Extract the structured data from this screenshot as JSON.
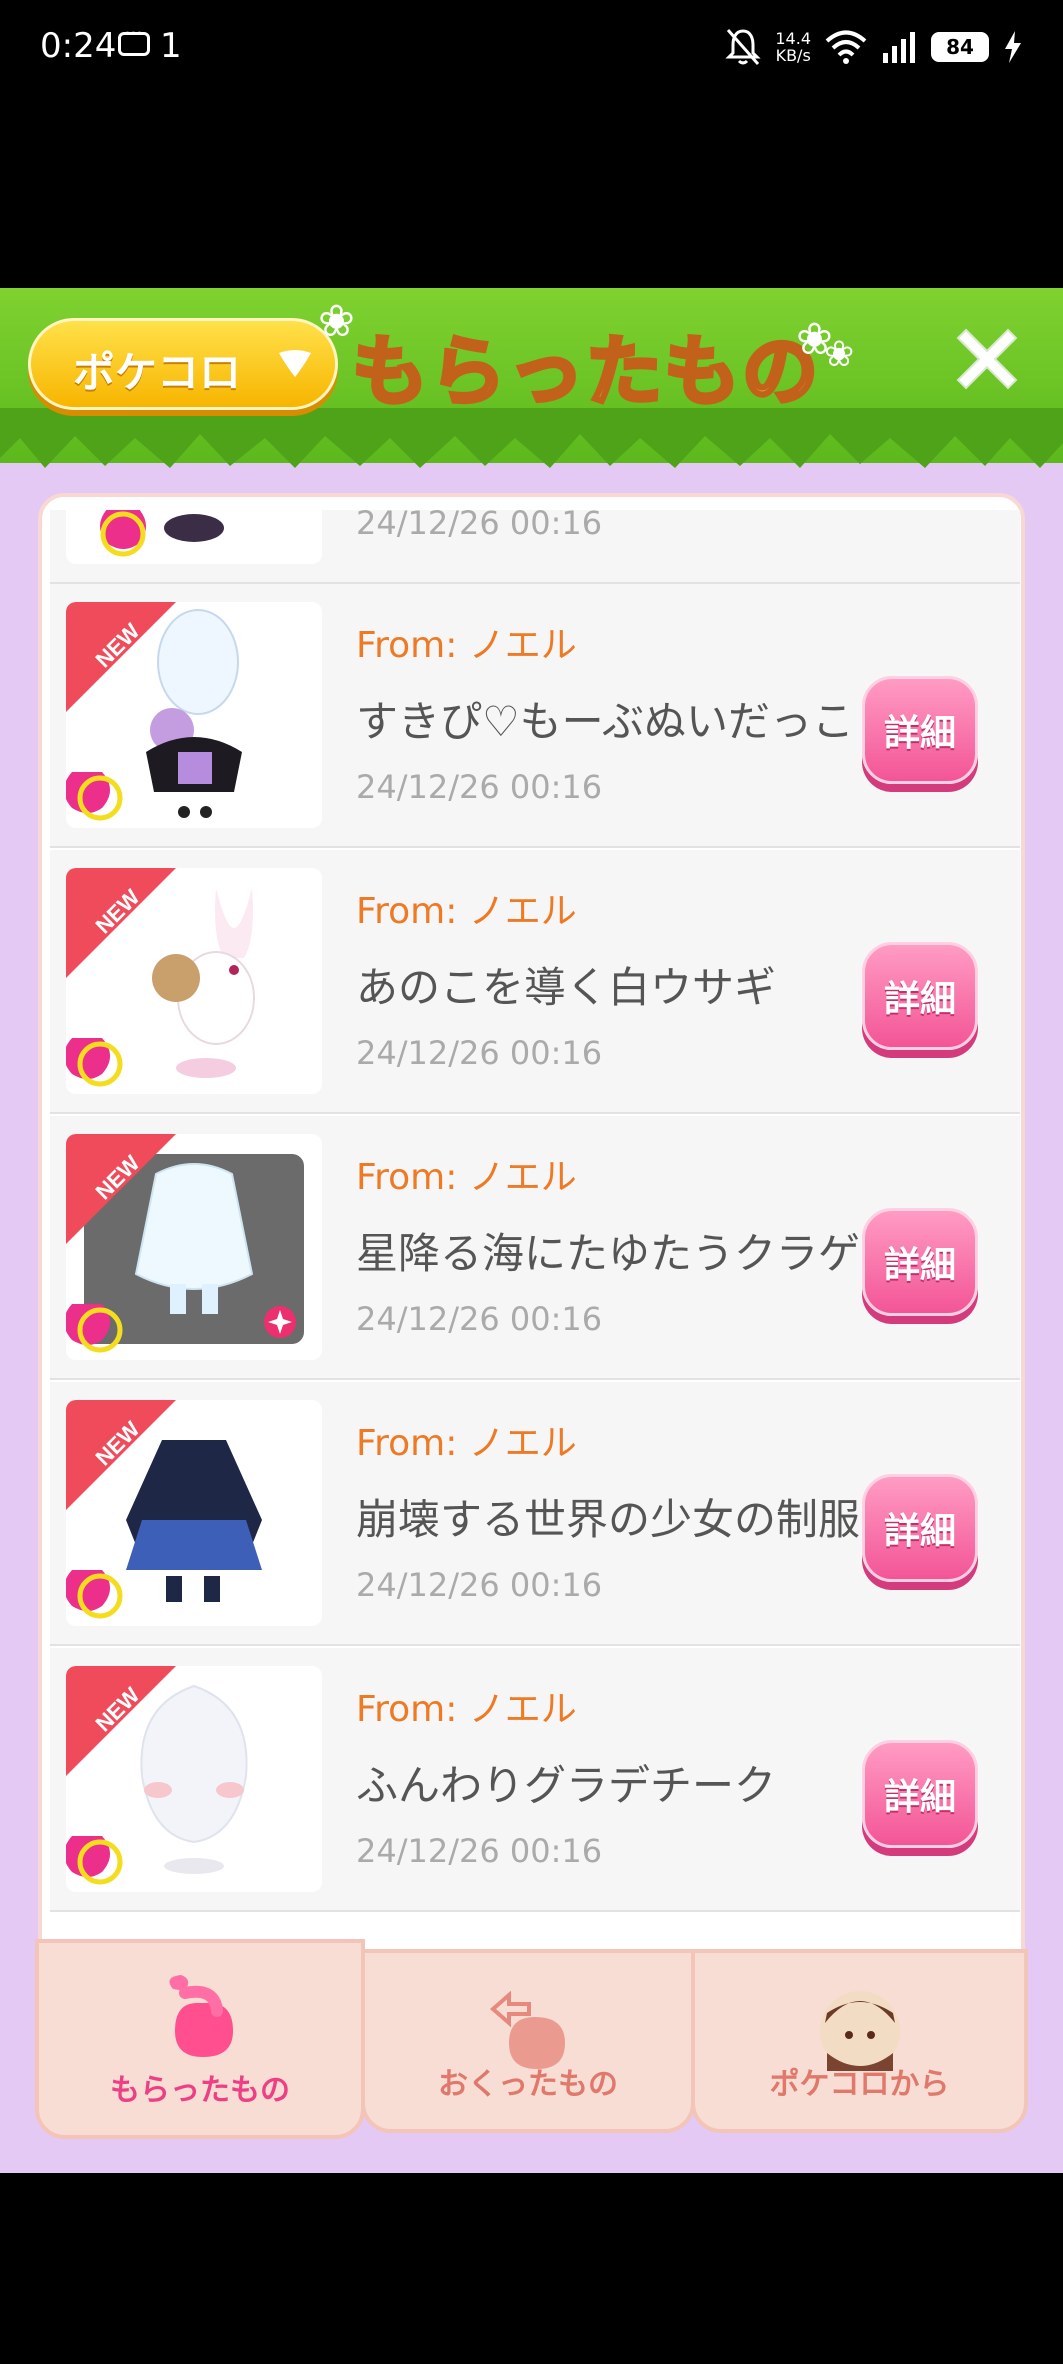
{
  "status_bar": {
    "time": "0:24",
    "notification_count": "1",
    "net_speed_value": "14.4",
    "net_speed_unit": "KB/s",
    "battery": "84"
  },
  "header": {
    "dropdown_label": "ポケコロ",
    "title": "もらったもの"
  },
  "gifts": [
    {
      "from": "",
      "name": "",
      "date": "24/12/26 00:16",
      "detail": ""
    },
    {
      "from": "From: ノエル",
      "name": "すきぴ♡もーぶぬいだっこ",
      "date": "24/12/26 00:16",
      "detail": "詳細",
      "badge": "NEW"
    },
    {
      "from": "From: ノエル",
      "name": "あのこを導く白ウサギ",
      "date": "24/12/26 00:16",
      "detail": "詳細",
      "badge": "NEW"
    },
    {
      "from": "From: ノエル",
      "name": "星降る海にたゆたうクラゲ",
      "date": "24/12/26 00:16",
      "detail": "詳細",
      "badge": "NEW"
    },
    {
      "from": "From: ノエル",
      "name": "崩壊する世界の少女の制服",
      "date": "24/12/26 00:16",
      "detail": "詳細",
      "badge": "NEW"
    },
    {
      "from": "From: ノエル",
      "name": "ふんわりグラデチーク",
      "date": "24/12/26 00:16",
      "detail": "詳細",
      "badge": "NEW"
    }
  ],
  "tabs": [
    {
      "label": "もらったもの",
      "active": true
    },
    {
      "label": "おくったもの",
      "active": false
    },
    {
      "label": "ポケコロから",
      "active": false
    }
  ],
  "colors": {
    "accent_pink": "#f35596",
    "from_orange": "#ee7a25",
    "header_green": "#5cb81c",
    "background_lavender": "#e3c9f3"
  }
}
